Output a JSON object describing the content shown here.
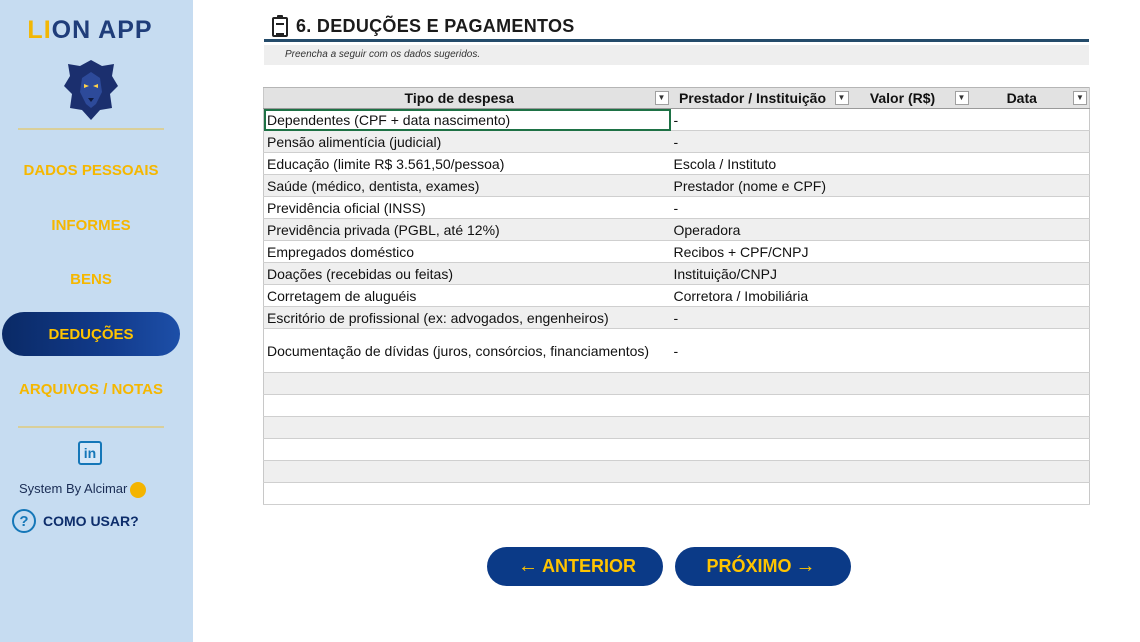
{
  "sidebar": {
    "app_title_first": "LI",
    "app_title_rest": "ON APP",
    "nav": [
      {
        "label": "DADOS PESSOAIS",
        "active": false
      },
      {
        "label": "INFORMES",
        "active": false
      },
      {
        "label": "BENS",
        "active": false
      },
      {
        "label": "DEDUÇÕES",
        "active": true
      },
      {
        "label": "ARQUIVOS / NOTAS",
        "active": false
      }
    ],
    "linkedin_icon": "in",
    "credit": "System By Alcimar",
    "help_icon": "?",
    "help_label": "COMO USAR?"
  },
  "section": {
    "title": "6. DEDUÇÕES E PAGAMENTOS",
    "hint": "Preencha a seguir com os dados sugeridos."
  },
  "table": {
    "headers": [
      "Tipo de despesa",
      "Prestador / Instituição",
      "Valor (R$)",
      "Data"
    ],
    "filter_glyph": "▼",
    "rows": [
      [
        "Dependentes (CPF + data nascimento)",
        "-",
        "",
        ""
      ],
      [
        "Pensão alimentícia (judicial)",
        "-",
        "",
        ""
      ],
      [
        "Educação (limite R$ 3.561,50/pessoa)",
        "Escola / Instituto",
        "",
        ""
      ],
      [
        "Saúde (médico, dentista, exames)",
        "Prestador (nome e CPF)",
        "",
        ""
      ],
      [
        "Previdência oficial (INSS)",
        "-",
        "",
        ""
      ],
      [
        "Previdência privada (PGBL, até 12%)",
        "Operadora",
        "",
        ""
      ],
      [
        "Empregados doméstico",
        "Recibos + CPF/CNPJ",
        "",
        ""
      ],
      [
        "Doações (recebidas ou feitas)",
        "Instituição/CNPJ",
        "",
        ""
      ],
      [
        "Corretagem de aluguéis",
        "Corretora / Imobiliária",
        "",
        ""
      ],
      [
        "Escritório de profissional (ex: advogados, engenheiros)",
        "-",
        "",
        ""
      ],
      [
        "Documentação de dívidas (juros, consórcios, financiamentos)",
        "-",
        "",
        ""
      ],
      [
        "",
        "",
        "",
        ""
      ],
      [
        "",
        "",
        "",
        ""
      ],
      [
        "",
        "",
        "",
        ""
      ],
      [
        "",
        "",
        "",
        ""
      ],
      [
        "",
        "",
        "",
        ""
      ],
      [
        "",
        "",
        "",
        ""
      ]
    ]
  },
  "buttons": {
    "prev_arrow": "←",
    "prev_label": "ANTERIOR",
    "next_label": "PRÓXIMO",
    "next_arrow": "→"
  },
  "colors": {
    "sidebar_bg": "#c6dcf1",
    "accent_gold": "#f5b700",
    "button_navy": "#0b3a87"
  }
}
